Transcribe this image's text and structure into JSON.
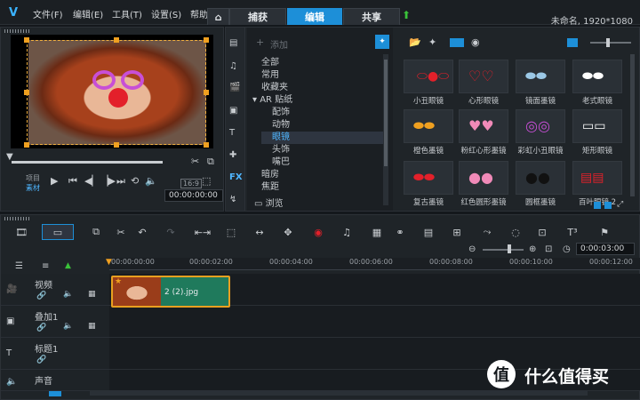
{
  "app": {
    "logo": "V",
    "project_title": "未命名, 1920*1080"
  },
  "menu": [
    "文件(F)",
    "编辑(E)",
    "工具(T)",
    "设置(S)",
    "帮助"
  ],
  "tabs": {
    "home_icon": "home-icon",
    "capture": "捕获",
    "edit": "编辑",
    "share": "共享",
    "upload_icon": "upload-arrow-icon"
  },
  "library": {
    "add_label": "添加",
    "categories": [
      "全部",
      "常用",
      "收藏夹",
      "AR 贴纸",
      "配饰",
      "动物",
      "眼镜",
      "头饰",
      "嘴巴",
      "暗房",
      "焦距"
    ],
    "browse_label": "浏览",
    "selected_category": "眼镜",
    "fx_label": "FX",
    "thumbs": [
      "小丑眼镜",
      "心形眼镜",
      "镜面墨镜",
      "老式眼镜",
      "橙色墨镜",
      "粉红心形墨镜",
      "彩虹小丑眼镜",
      "矩形眼镜",
      "复古墨镜",
      "红色圆形墨镜",
      "圆框墨镜",
      "百叶眼镜 2"
    ]
  },
  "preview": {
    "label_project": "项目",
    "label_clip": "素材",
    "aspect": "16:9",
    "timecode": "00:00:00:00"
  },
  "timeline": {
    "ruler": [
      "00:00:00:00",
      "00:00:02:00",
      "00:00:04:00",
      "00:00:06:00",
      "00:00:08:00",
      "00:00:10:00",
      "00:00:12:00"
    ],
    "timecode": "0:00:03:00",
    "tracks": [
      "视频",
      "叠加1",
      "标题1",
      "声音"
    ],
    "clip_name": "2 (2).jpg"
  },
  "watermark": {
    "icon": "值",
    "text": "什么值得买"
  }
}
